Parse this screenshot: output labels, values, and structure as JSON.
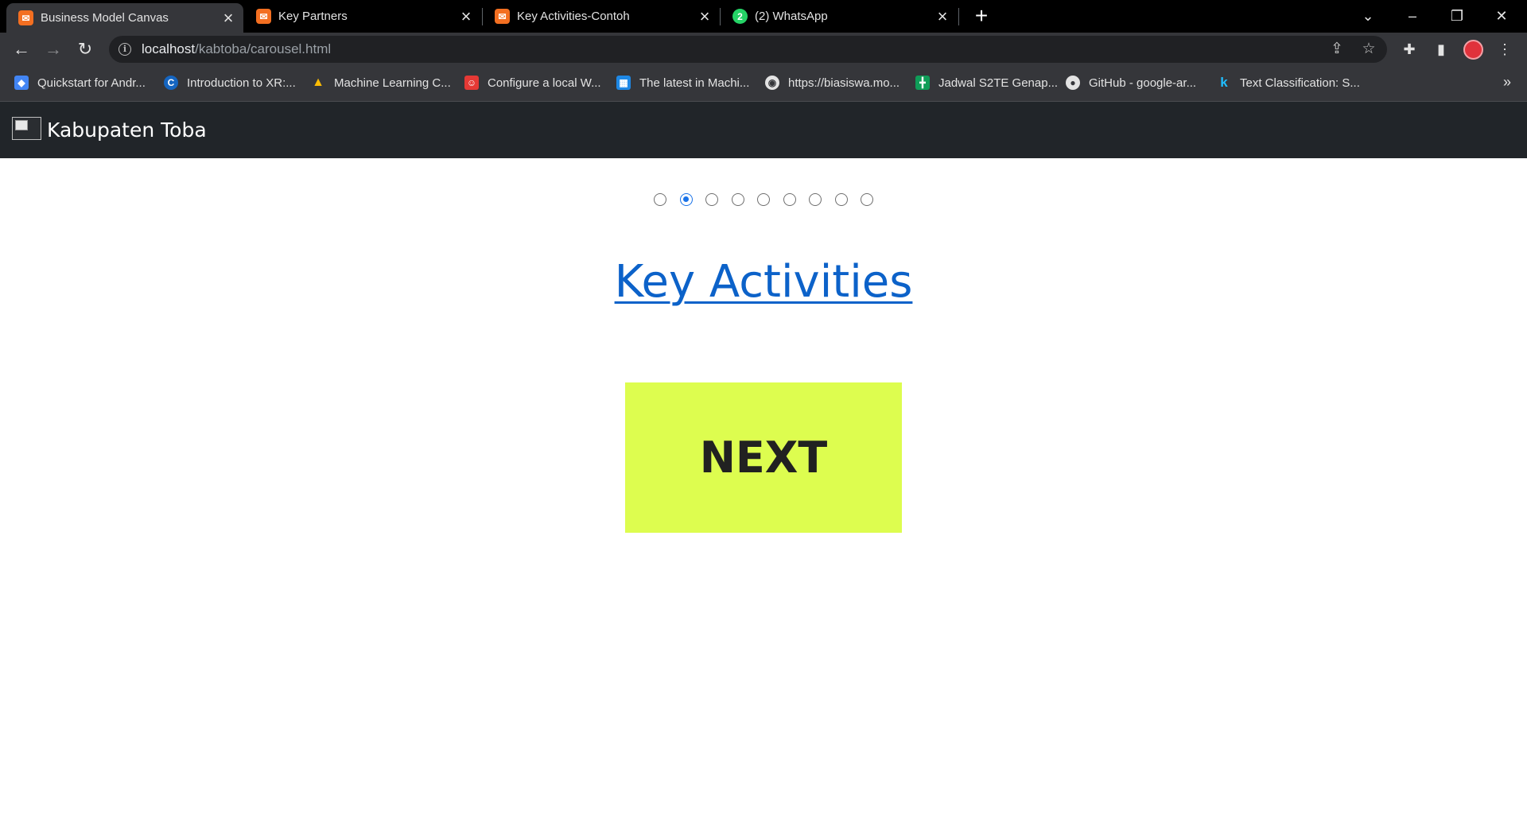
{
  "browser": {
    "tabs": [
      {
        "title": "Business Model Canvas",
        "favicon": "xampp-icon",
        "active": true
      },
      {
        "title": "Key Partners",
        "favicon": "xampp-icon",
        "active": false
      },
      {
        "title": "Key Activities-Contoh",
        "favicon": "xampp-icon",
        "active": false
      },
      {
        "title": "(2) WhatsApp",
        "favicon": "whatsapp-icon",
        "active": false
      }
    ],
    "address": {
      "host": "localhost",
      "path": "/kabtoba/carousel.html"
    },
    "bookmarks": [
      {
        "label": "Quickstart for Andr...",
        "icon": "flutter-icon",
        "color": "#4285f4"
      },
      {
        "label": "Introduction to XR:...",
        "icon": "coursera-icon",
        "color": "#1565c0"
      },
      {
        "label": "Machine Learning C...",
        "icon": "google-drive-icon",
        "color": "#0f9d58"
      },
      {
        "label": "Configure a local W...",
        "icon": "mascot-icon",
        "color": "#e53935"
      },
      {
        "label": "The latest in Machi...",
        "icon": "paperswithcode-icon",
        "color": "#1e88e5"
      },
      {
        "label": "https://biasiswa.mo...",
        "icon": "globe-icon",
        "color": "#9e9e9e"
      },
      {
        "label": "Jadwal S2TE Genap...",
        "icon": "google-sheets-icon",
        "color": "#0f9d58"
      },
      {
        "label": "GitHub - google-ar...",
        "icon": "github-icon",
        "color": "#333333"
      },
      {
        "label": "Text Classification: S...",
        "icon": "kaggle-icon",
        "color": "#20beff"
      }
    ]
  },
  "page": {
    "brand": "Kabupaten Toba",
    "carousel": {
      "total_slides": 9,
      "active_index": 1
    },
    "heading": "Key Activities",
    "next_label": "NEXT",
    "accent": "#ddfd4f",
    "link_color": "#0c62c9"
  }
}
